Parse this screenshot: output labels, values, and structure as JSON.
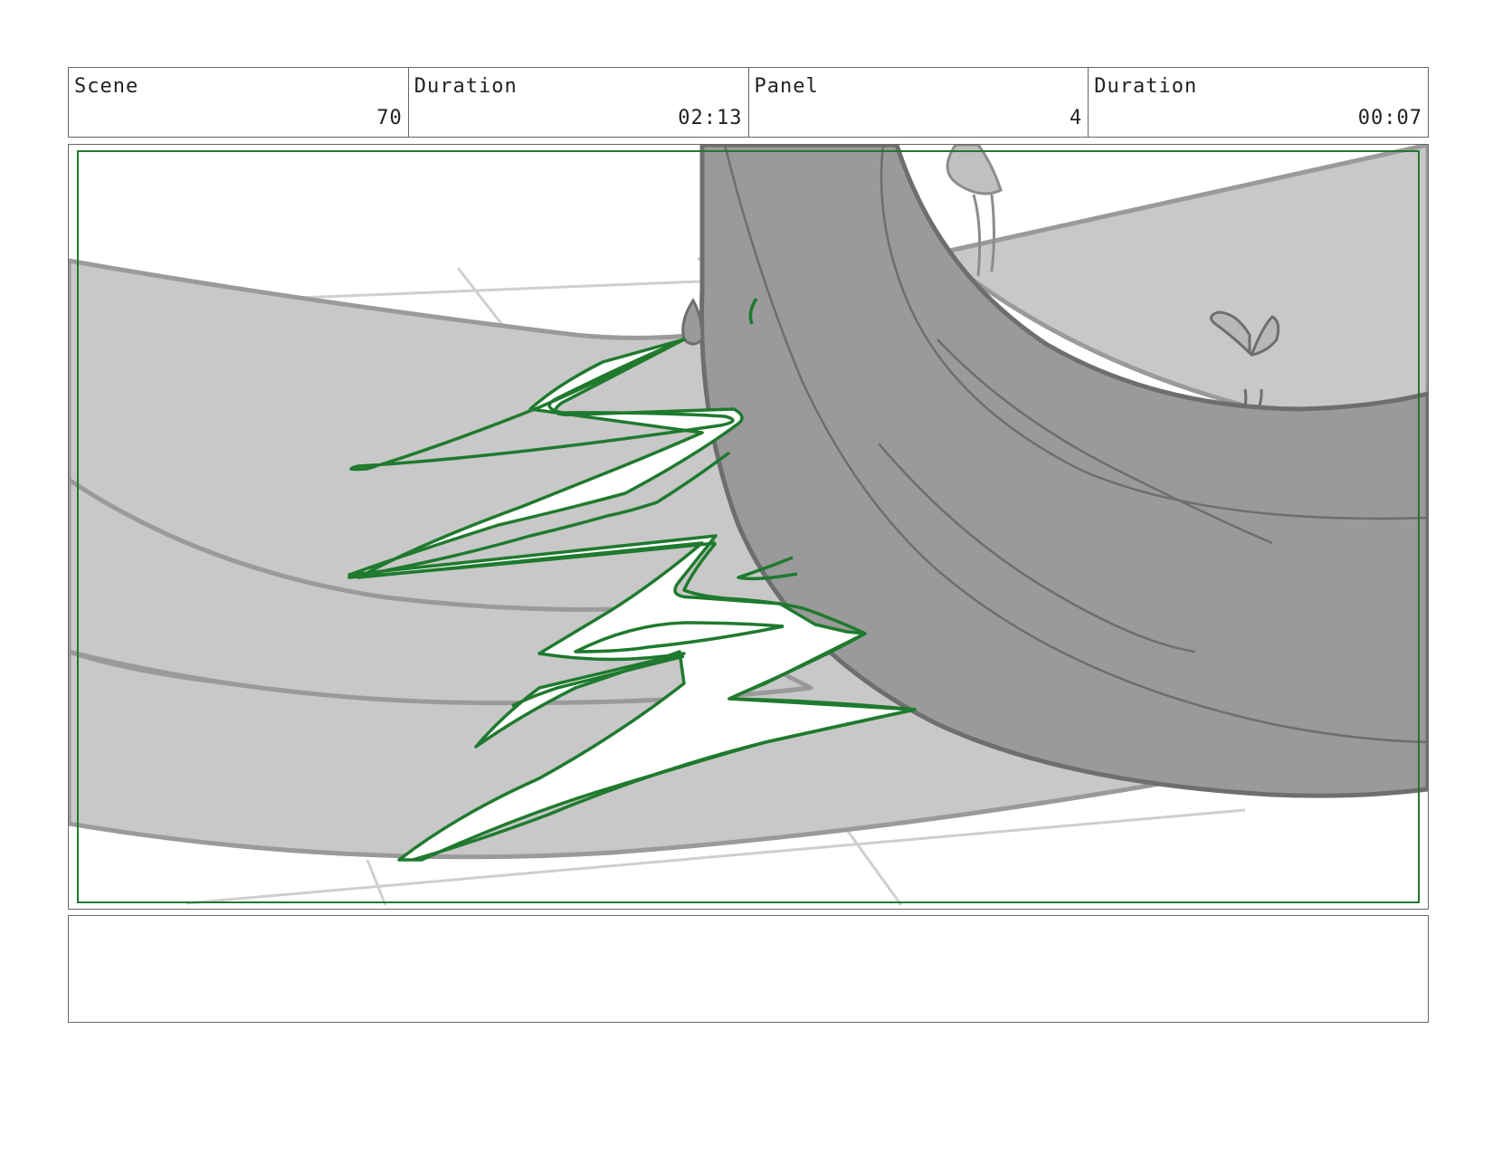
{
  "header": {
    "scene_label": "Scene",
    "scene_value": "70",
    "scene_duration_label": "Duration",
    "scene_duration_value": "02:13",
    "panel_label": "Panel",
    "panel_value": "4",
    "panel_duration_label": "Duration",
    "panel_duration_value": "00:07"
  },
  "panel": {
    "artwork": "storyboard-sketch",
    "safe_frame_color": "#1f7a2e"
  },
  "notes": {
    "text": ""
  },
  "colors": {
    "border": "#666666",
    "light_gray": "#c8c8c8",
    "dark_gray": "#999999",
    "outline_gray": "#8c8c8c",
    "energy_green": "#1f7a2e"
  }
}
